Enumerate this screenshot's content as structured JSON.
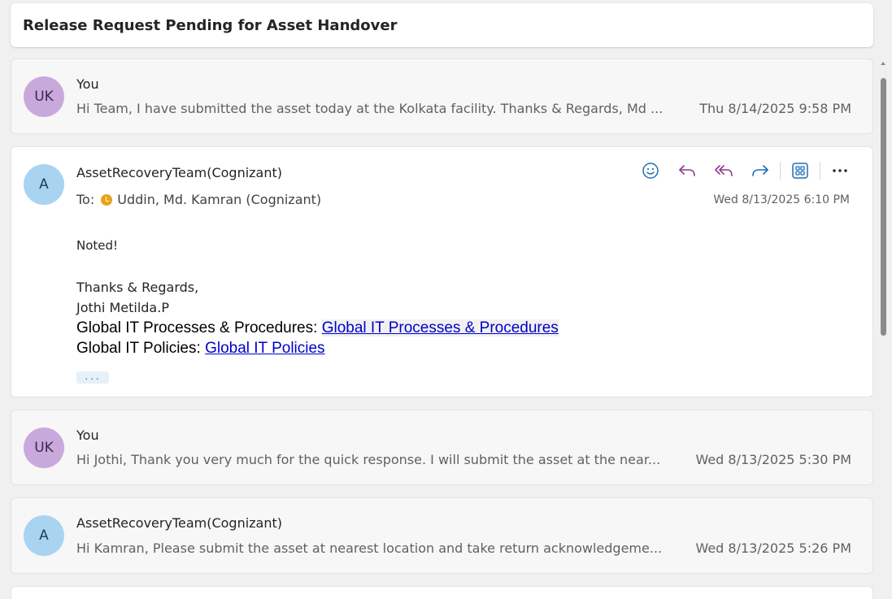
{
  "thread": {
    "subject": "Release Request Pending for Asset Handover"
  },
  "messages": [
    {
      "initials": "UK",
      "sender": "You",
      "preview": "Hi Team, I have submitted the asset today at the Kolkata facility. Thanks & Regards, Md ...",
      "date": "Thu 8/14/2025 9:58 PM"
    },
    {
      "initials": "A",
      "sender": "AssetRecoveryTeam(Cognizant)",
      "to_label": "To:",
      "to_name": "Uddin, Md. Kamran (Cognizant)",
      "date": "Wed 8/13/2025 6:10 PM",
      "body": {
        "noted": "Noted!",
        "regards": "Thanks & Regards,",
        "signature_name": "Jothi Metilda.P",
        "processes_label": "Global IT Processes & Procedures:",
        "processes_link": " Global IT Processes & Procedures",
        "policies_label": "Global IT Policies:",
        "policies_link": " Global IT Policies",
        "more": "···"
      },
      "actions": [
        "emoji-icon",
        "reply-icon",
        "reply-all-icon",
        "forward-icon",
        "apps-icon",
        "more-icon"
      ]
    },
    {
      "initials": "UK",
      "sender": "You",
      "preview": "Hi Jothi, Thank you very much for the quick response. I will submit the asset at the near...",
      "date": "Wed 8/13/2025 5:30 PM"
    },
    {
      "initials": "A",
      "sender": "AssetRecoveryTeam(Cognizant)",
      "preview": "Hi Kamran, Please submit the asset at nearest location and take return acknowledgeme...",
      "date": "Wed 8/13/2025 5:26 PM"
    }
  ],
  "colors": {
    "avatar_you": "#c9a9dc",
    "avatar_team": "#a8d4f2",
    "action_blue": "#1f6fb5",
    "action_purple": "#8a3a8c",
    "presence_away": "#e8a317",
    "link": "#0000cc"
  }
}
